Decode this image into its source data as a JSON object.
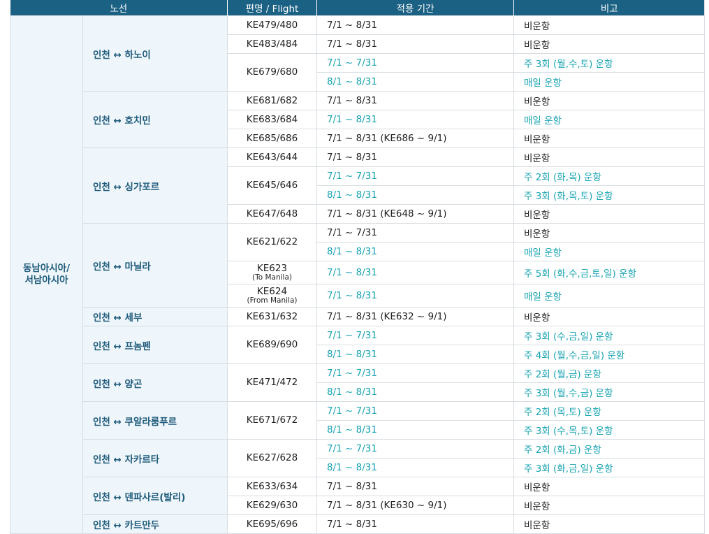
{
  "headers": [
    "노선",
    "편명 / Flight",
    "적용 기간",
    "비고"
  ],
  "region": "동남아시아/ 서남아시아",
  "region_lines": [
    "동남아시아/",
    "서남아시아"
  ],
  "routes": [
    {
      "name": "인천 ↔ 하노이",
      "rows": [
        {
          "flight": "KE479/480",
          "period": "7/1 ~ 8/31",
          "note": "비운항",
          "hl": false
        },
        {
          "flight": "KE483/484",
          "period": "7/1 ~ 8/31",
          "note": "비운항",
          "hl": false
        },
        {
          "flight": "KE679/680",
          "period": "7/1 ~ 7/31",
          "note": "주 3회 (월,수,토) 운항",
          "hl": true
        },
        {
          "flight": "",
          "period": "8/1 ~ 8/31",
          "note": "매일 운항",
          "hl": true
        }
      ]
    },
    {
      "name": "인천 ↔ 호치민",
      "rows": [
        {
          "flight": "KE681/682",
          "period": "7/1 ~ 8/31",
          "note": "비운항",
          "hl": false
        },
        {
          "flight": "KE683/684",
          "period": "7/1 ~ 8/31",
          "note": "매일 운항",
          "hl": true
        },
        {
          "flight": "KE685/686",
          "period": "7/1 ~ 8/31 (KE686 ~ 9/1)",
          "note": "비운항",
          "hl": false
        }
      ]
    },
    {
      "name": "인천 ↔ 싱가포르",
      "rows": [
        {
          "flight": "KE643/644",
          "period": "7/1 ~ 8/31",
          "note": "비운항",
          "hl": false
        },
        {
          "flight": "KE645/646",
          "period": "7/1 ~ 7/31",
          "note": "주 2회 (화,목) 운항",
          "hl": true
        },
        {
          "flight": "",
          "period": "8/1 ~ 8/31",
          "note": "주 3회 (화,목,토) 운항",
          "hl": true
        },
        {
          "flight": "KE647/648",
          "period": "7/1 ~ 8/31 (KE648 ~ 9/1)",
          "note": "비운항",
          "hl": false
        }
      ]
    },
    {
      "name": "인천 ↔ 마닐라",
      "rows": [
        {
          "flight": "KE621/622",
          "period": "7/1 ~ 7/31",
          "note": "비운항",
          "hl": false
        },
        {
          "flight": "",
          "period": "8/1 ~ 8/31",
          "note": "매일 운항",
          "hl": true
        },
        {
          "flight": "KE623",
          "flight_sub": "(To Manila)",
          "period": "7/1 ~ 8/31",
          "note": "주 5회 (화,수,금,토,일) 운항",
          "hl": true
        },
        {
          "flight": "KE624",
          "flight_sub": "(From Manila)",
          "period": "7/1 ~ 8/31",
          "note": "매일 운항",
          "hl": true
        }
      ]
    },
    {
      "name": "인천 ↔ 세부",
      "rows": [
        {
          "flight": "KE631/632",
          "period": "7/1 ~ 8/31 (KE632 ~ 9/1)",
          "note": "비운항",
          "hl": false
        }
      ]
    },
    {
      "name": "인천 ↔ 프놈펜",
      "rows": [
        {
          "flight": "KE689/690",
          "period": "7/1 ~ 7/31",
          "note": "주 3회 (수,금,일) 운항",
          "hl": true
        },
        {
          "flight": "",
          "period": "8/1 ~ 8/31",
          "note": "주 4회 (월,수,금,일) 운항",
          "hl": true
        }
      ]
    },
    {
      "name": "인천 ↔ 양곤",
      "rows": [
        {
          "flight": "KE471/472",
          "period": "7/1 ~ 7/31",
          "note": "주 2회 (월,금) 운항",
          "hl": true
        },
        {
          "flight": "",
          "period": "8/1 ~ 8/31",
          "note": "주 3회 (월,수,금) 운항",
          "hl": true
        }
      ]
    },
    {
      "name": "인천 ↔ 쿠알라룸푸르",
      "rows": [
        {
          "flight": "KE671/672",
          "period": "7/1 ~ 7/31",
          "note": "주 2회 (목,토) 운항",
          "hl": true
        },
        {
          "flight": "",
          "period": "8/1 ~ 8/31",
          "note": "주 3회 (수,목,토) 운항",
          "hl": true
        }
      ]
    },
    {
      "name": "인천 ↔ 자카르타",
      "rows": [
        {
          "flight": "KE627/628",
          "period": "7/1 ~ 7/31",
          "note": "주 2회 (화,금) 운항",
          "hl": true
        },
        {
          "flight": "",
          "period": "8/1 ~ 8/31",
          "note": "주 3회 (화,금,일) 운항",
          "hl": true
        }
      ]
    },
    {
      "name": "인천 ↔ 덴파사르(발리)",
      "rows": [
        {
          "flight": "KE633/634",
          "period": "7/1 ~ 8/31",
          "note": "비운항",
          "hl": false
        },
        {
          "flight": "KE629/630",
          "period": "7/1 ~ 8/31 (KE630 ~ 9/1)",
          "note": "비운항",
          "hl": false
        }
      ]
    },
    {
      "name": "인천 ↔ 카트만두",
      "rows": [
        {
          "flight": "KE695/696",
          "period": "7/1 ~ 8/31",
          "note": "비운항",
          "hl": false
        }
      ]
    }
  ],
  "colors": {
    "header_bg": "#1b6184",
    "route_bg": "#eef6fb",
    "route_text": "#1e5a7a",
    "highlight": "#17a3b2",
    "border": "#d7dde2"
  }
}
